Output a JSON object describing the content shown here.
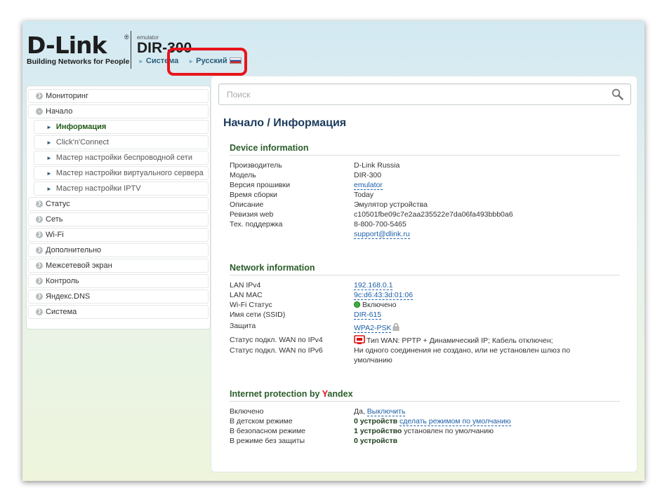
{
  "header": {
    "logo_text": "D-Link",
    "logo_reg": "®",
    "tagline": "Building Networks for People",
    "model_sub": "emulator",
    "model_name": "DIR-300",
    "system_label": "Система",
    "language_label": "Русский"
  },
  "sidebar": {
    "items": [
      {
        "label": "Мониторинг"
      },
      {
        "label": "Начало"
      },
      {
        "label": "Информация"
      },
      {
        "label": "Click'n'Connect"
      },
      {
        "label": "Мастер настройки беспроводной сети"
      },
      {
        "label": "Мастер настройки виртуального сервера"
      },
      {
        "label": "Мастер настройки IPTV"
      },
      {
        "label": "Статус"
      },
      {
        "label": "Сеть"
      },
      {
        "label": "Wi-Fi"
      },
      {
        "label": "Дополнительно"
      },
      {
        "label": "Межсетевой экран"
      },
      {
        "label": "Контроль"
      },
      {
        "label": "Яндекс.DNS"
      },
      {
        "label": "Система"
      }
    ]
  },
  "search": {
    "placeholder": "Поиск"
  },
  "page_title": "Начало /  Информация",
  "device": {
    "title": "Device information",
    "rows": [
      {
        "k": "Производитель",
        "v": "D-Link Russia"
      },
      {
        "k": "Модель",
        "v": "DIR-300"
      },
      {
        "k": "Версия прошивки",
        "v": "emulator"
      },
      {
        "k": "Время сборки",
        "v": "Today"
      },
      {
        "k": "Описание",
        "v": "Эмулятор устройства"
      },
      {
        "k": "Ревизия web",
        "v": "c10501fbe09c7e2aa235522e7da06fa493bbb0a6"
      },
      {
        "k": "Тех. поддержка",
        "v": "8-800-700-5465",
        "v2": "support@dlink.ru"
      }
    ]
  },
  "network": {
    "title": "Network information",
    "rows": [
      {
        "k": "LAN IPv4",
        "v": "192.168.0.1"
      },
      {
        "k": "LAN MAC",
        "v": "9c:d6:43:3d:01:06"
      },
      {
        "k": "Wi-Fi Статус",
        "v": "Включено"
      },
      {
        "k": "Имя сети (SSID)",
        "v": "DIR-615"
      },
      {
        "k": "Защита",
        "v": "WPA2-PSK"
      },
      {
        "k": "Статус подкл. WAN по IPv4",
        "v": "Тип WAN: PPTP + Динамический IP; Кабель отключен;"
      },
      {
        "k": "Статус подкл. WAN по IPv6",
        "v": "Ни одного соединения не создано, или не установлен шлюз по умолчанию"
      }
    ]
  },
  "yandex": {
    "title_prefix": "Internet protection by ",
    "title_y": "Y",
    "title_rest": "andex",
    "rows": [
      {
        "k": "Включено",
        "v": "Да, ",
        "link": "Выключить"
      },
      {
        "k": "В детском режиме",
        "v": "0 устройств",
        "link": "сделать режимом по умолчанию"
      },
      {
        "k": "В безопасном режиме",
        "v": "1 устройство",
        "rest": "установлен по умолчанию"
      },
      {
        "k": "В режиме без защиты",
        "v": "0 устройств"
      }
    ]
  },
  "colors": {
    "accent": "#1c5fa8",
    "section": "#2a5d2a",
    "highlight": "#e8151b",
    "status_on": "#3ab23a"
  }
}
